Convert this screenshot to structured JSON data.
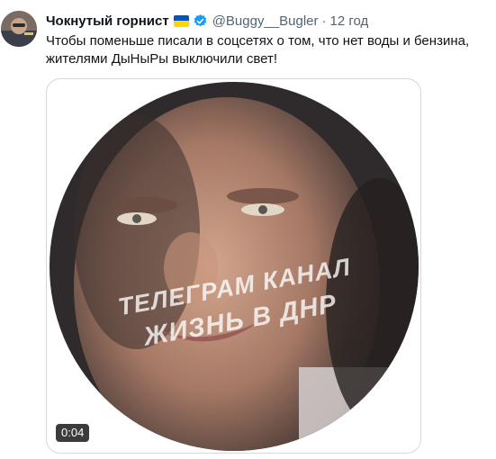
{
  "tweet": {
    "author_name": "Чокнутый горнист",
    "handle": "@Buggy__Bugler",
    "separator": "·",
    "timestamp": "12 год",
    "text": "Чтобы поменьше писали в соцсетях о том, что нет воды и бензина, жителями ДыНыРы выключили свет!"
  },
  "media": {
    "watermark_line1": "ТЕЛЕГРАМ КАНАЛ",
    "watermark_line2": "ЖИЗНЬ В ДНР",
    "duration": "0:04"
  },
  "icons": {
    "flag": "ukraine-flag-icon",
    "verified": "verified-badge-icon"
  },
  "colors": {
    "verified": "#1d9bf0",
    "flag_blue": "#0057b7",
    "flag_yellow": "#ffd700"
  }
}
